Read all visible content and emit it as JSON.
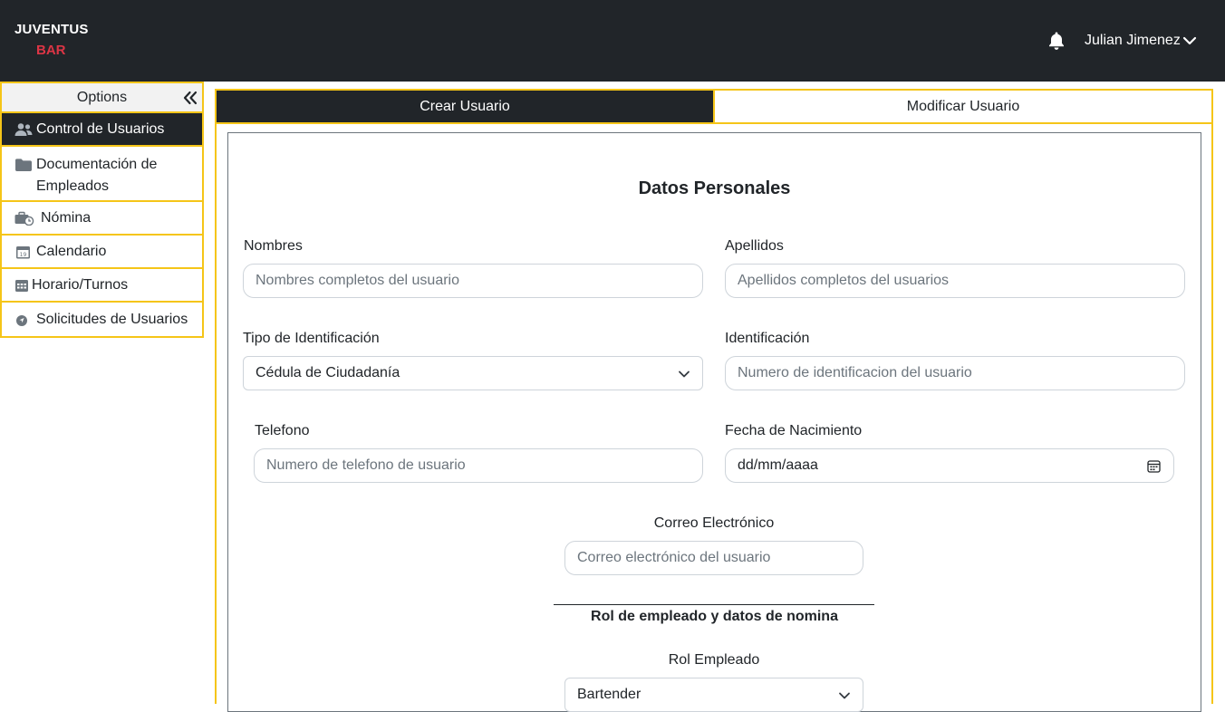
{
  "brand": {
    "line1": "JUVENTUS",
    "line2": "BAR"
  },
  "header": {
    "user_name": "Julian Jimenez",
    "bell_icon": "bell-icon",
    "chevron_icon": "chevron-down-icon"
  },
  "sidebar": {
    "title": "Options",
    "items": [
      {
        "label": "Control de Usuarios",
        "icon": "users-icon",
        "active": true
      },
      {
        "label": "Documentación de Empleados",
        "icon": "folder-icon",
        "active": false
      },
      {
        "label": "Nómina",
        "icon": "briefcase-clock-icon",
        "active": false
      },
      {
        "label": "Calendario",
        "icon": "calendar-icon",
        "active": false
      },
      {
        "label": "Horario/Turnos",
        "icon": "calendar-grid-icon",
        "active": false
      },
      {
        "label": "Solicitudes de Usuarios",
        "icon": "location-arrow-icon",
        "active": false
      }
    ]
  },
  "tabs": [
    {
      "label": "Crear Usuario",
      "active": true
    },
    {
      "label": "Modificar Usuario",
      "active": false
    }
  ],
  "form": {
    "section_title": "Datos Personales",
    "nombres": {
      "label": "Nombres",
      "placeholder": "Nombres completos del usuario"
    },
    "apellidos": {
      "label": "Apellidos",
      "placeholder": "Apellidos completos del usuarios"
    },
    "tipo_id": {
      "label": "Tipo de Identificación",
      "value": "Cédula de Ciudadanía"
    },
    "identificacion": {
      "label": "Identificación",
      "placeholder": "Numero de identificacion del usuario"
    },
    "telefono": {
      "label": "Telefono",
      "placeholder": "Numero de telefono de usuario"
    },
    "fecha": {
      "label": "Fecha de Nacimiento",
      "value": "dd/mm/aaaa"
    },
    "correo": {
      "label": "Correo Electrónico",
      "placeholder": "Correo electrónico del usuario"
    },
    "subsection_title": "Rol de empleado y datos de nomina",
    "rol": {
      "label": "Rol Empleado",
      "value": "Bartender"
    }
  },
  "colors": {
    "navbar": "#212529",
    "accent": "#f5c518",
    "brand_red": "#dc3545"
  }
}
